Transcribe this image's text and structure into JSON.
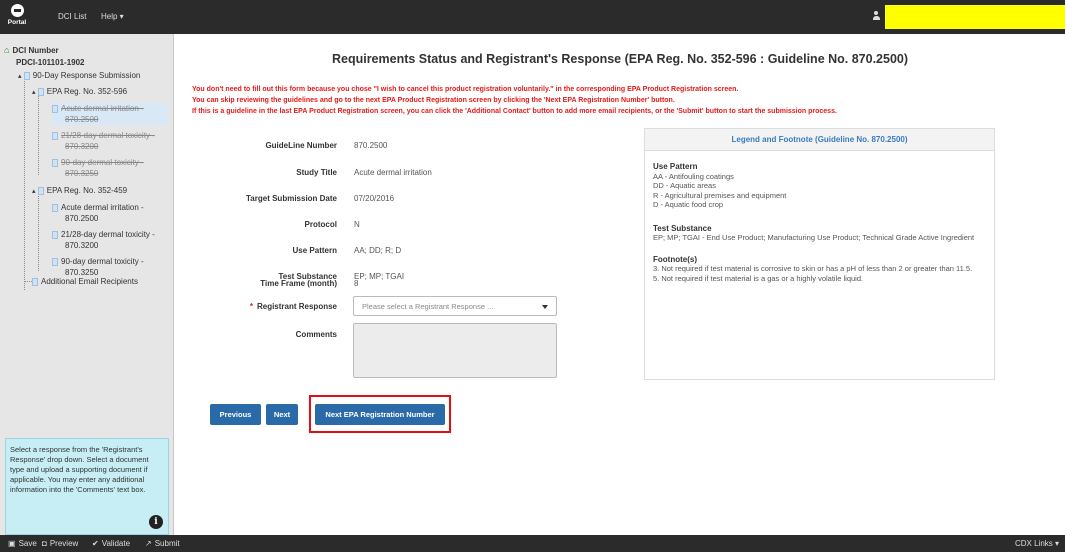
{
  "topbar": {
    "logo_text": "Portal",
    "nav": [
      {
        "label": "DCI List"
      },
      {
        "label": "Help ▾"
      }
    ]
  },
  "sidebar": {
    "root": "DCI Number",
    "dci_id": "PDCI-101101-1902",
    "tree": {
      "submission": "90-Day Response Submission",
      "reg1": "EPA Reg. No. 352-596",
      "reg1_items": [
        {
          "line1": "Acute dermal irritation -",
          "line2": "870.2500"
        },
        {
          "line1": "21/28-day dermal toxicity -",
          "line2": "870.3200"
        },
        {
          "line1": "90-day dermal toxicity -",
          "line2": "870.3250"
        }
      ],
      "reg2": "EPA Reg. No. 352-459",
      "reg2_items": [
        {
          "line1": "Acute dermal irritation -",
          "line2": "870.2500"
        },
        {
          "line1": "21/28-day dermal toxicity -",
          "line2": "870.3200"
        },
        {
          "line1": "90-day dermal toxicity -",
          "line2": "870.3250"
        }
      ],
      "extra": "Additional Email Recipients"
    },
    "help_text": "Select a response from the 'Registrant's Response' drop down. Select a document type and upload a supporting document if applicable. You may enter any additional information into the 'Comments' text box."
  },
  "main": {
    "title": "Requirements Status and Registrant's Response (EPA Reg. No. 352-596 : Guideline No. 870.2500)",
    "warnings": [
      "You don't need to fill out this form because you chose \"I wish to cancel this product registration voluntarily.\" in the corresponding EPA Product Registration screen.",
      "You can skip reviewing the guidelines and go to the next EPA Product Registration screen by clicking the 'Next EPA Registration Number' button.",
      "If this is a guideline in the last EPA Product Registration screen, you can click the 'Additional Contact' button to add more email recipients, or the 'Submit' button to start the submission process."
    ],
    "fields": {
      "guideline_label": "GuideLine Number",
      "guideline_value": "870.2500",
      "study_label": "Study Title",
      "study_value": "Acute dermal irritation",
      "target_label": "Target Submission Date",
      "target_value": "07/20/2016",
      "protocol_label": "Protocol",
      "protocol_value": "N",
      "use_label": "Use Pattern",
      "use_value": "AA; DD; R; D",
      "test_label": "Test Substance",
      "test_value": "EP; MP; TGAI",
      "time_label": "Time Frame (month)",
      "time_value": "8",
      "response_star": "*",
      "response_label": "Registrant Response",
      "response_placeholder": "Please select a Registrant Response ...",
      "comments_label": "Comments"
    },
    "legend": {
      "header": "Legend and Footnote (Guideline No. 870.2500)",
      "use_pattern_title": "Use Pattern",
      "use_pattern": [
        "AA - Antifouling coatings",
        "DD - Aquatic areas",
        "R - Agricultural premises and equipment",
        "D - Aquatic food crop"
      ],
      "test_substance_title": "Test Substance",
      "test_substance": "EP; MP; TGAI - End Use Product; Manufacturing Use Product; Technical Grade Active Ingredient",
      "footnotes_title": "Footnote(s)",
      "footnotes": [
        "3. Not required if test material is corrosive to skin or has a pH of less than 2 or greater than 11.5.",
        "5. Not required if test material is a gas or a highly volatile liquid."
      ]
    },
    "buttons": {
      "previous": "Previous",
      "next": "Next",
      "next_epa": "Next EPA Registration Number"
    }
  },
  "bottombar": {
    "save": "Save",
    "preview": "Preview",
    "validate": "Validate",
    "submit": "Submit",
    "cdx_links": "CDX Links ▾"
  }
}
